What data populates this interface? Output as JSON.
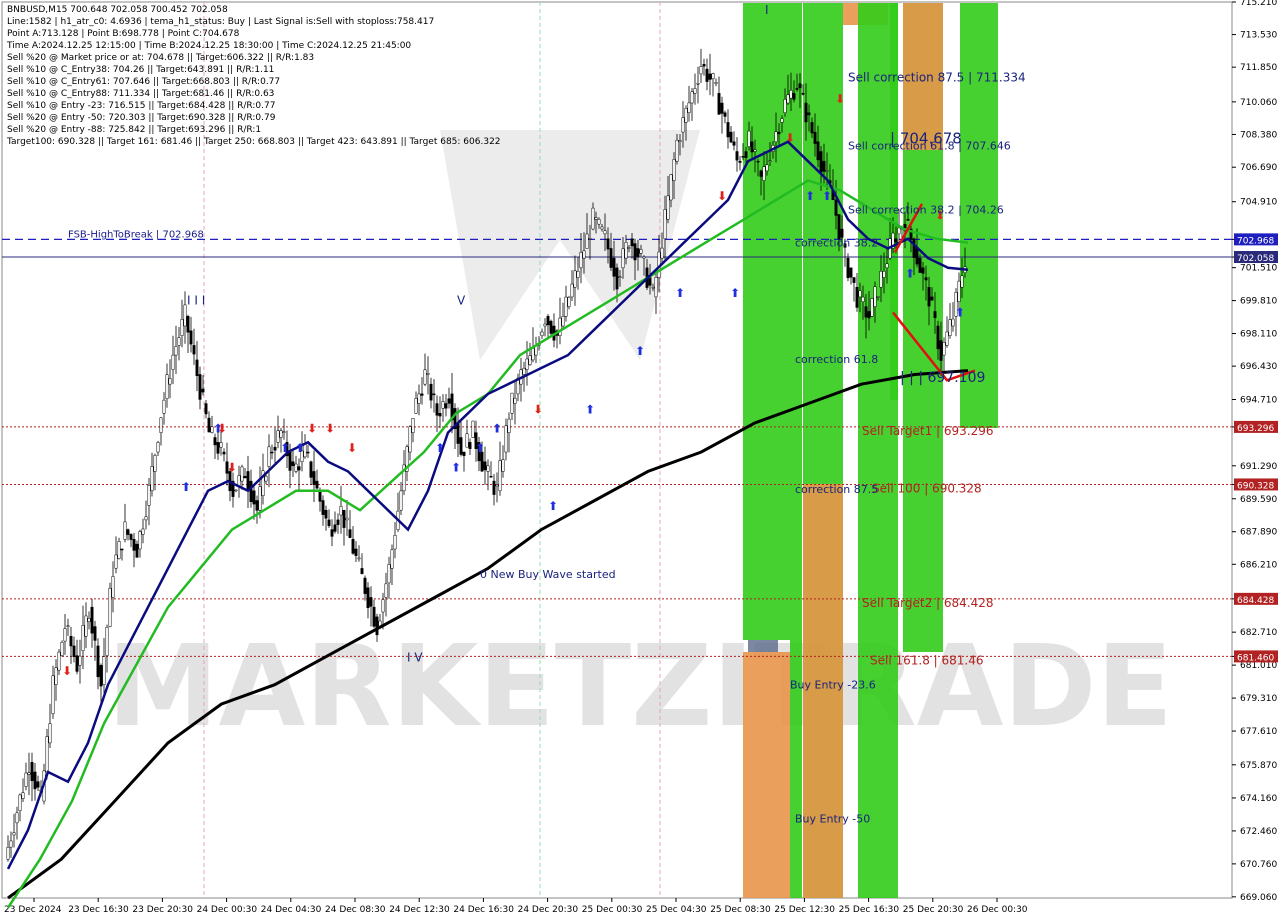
{
  "header": {
    "symbol_line": "BNBUSD,M15  700.648 702.058 700.452 702.058",
    "lines": [
      "Line:1582 | h1_atr_c0: 4.6936 | tema_h1_status: Buy | Last Signal is:Sell with stoploss:758.417",
      "Point A:713.128 | Point B:698.778 | Point C:704.678",
      "Time A:2024.12.25 12:15:00 | Time B:2024.12.25 18:30:00 | Time C:2024.12.25 21:45:00",
      "Sell %20 @ Market price or at: 704.678 || Target:606.322 || R/R:1.83",
      "Sell %10 @ C_Entry38: 704.26 || Target:643.891 || R/R:1.11",
      "Sell %10 @ C_Entry61: 707.646 || Target:668.803 || R/R:0.77",
      "Sell %10 @ C_Entry88: 711.334 || Target:681.46 || R/R:0.63",
      "Sell %10 @ Entry -23: 716.515 || Target:684.428 || R/R:0.77",
      "Sell %20 @ Entry -50: 720.303 || Target:690.328 || R/R:0.79",
      "Sell %20 @ Entry -88: 725.842 || Target:693.296 || R/R:1",
      "Target100: 690.328 || Target 161: 681.46 || Target 250: 668.803 || Target 423: 643.891 || Target 685: 606.322"
    ]
  },
  "watermark": "MARKETZITRADE",
  "chart_data": {
    "type": "candlestick",
    "symbol": "BNBUSD",
    "timeframe": "M15",
    "ylim": [
      669.0,
      715.21
    ],
    "y_ticks": [
      "715.210",
      "713.530",
      "711.850",
      "710.060",
      "708.380",
      "706.690",
      "704.910",
      "702.968",
      "702.058",
      "701.510",
      "699.810",
      "698.110",
      "696.430",
      "694.710",
      "693.296",
      "691.290",
      "690.328",
      "689.590",
      "687.890",
      "686.210",
      "684.428",
      "682.710",
      "681.460",
      "681.010",
      "679.310",
      "677.610",
      "675.870",
      "674.160",
      "672.460",
      "670.760",
      "669.060"
    ],
    "x_ticks": [
      "23 Dec 2024",
      "23 Dec 16:30",
      "23 Dec 20:30",
      "24 Dec 00:30",
      "24 Dec 04:30",
      "24 Dec 08:30",
      "24 Dec 12:30",
      "24 Dec 16:30",
      "24 Dec 20:30",
      "25 Dec 00:30",
      "25 Dec 04:30",
      "25 Dec 08:30",
      "25 Dec 12:30",
      "25 Dec 16:30",
      "25 Dec 20:30",
      "26 Dec 00:30"
    ],
    "close_path": [
      671,
      673.5,
      676,
      674,
      680,
      683,
      681,
      684,
      680,
      686,
      688,
      687,
      690,
      694,
      697,
      699,
      696,
      693,
      692,
      690,
      691,
      689,
      692,
      693,
      691,
      692,
      690,
      688,
      689,
      687,
      685,
      683,
      686,
      690,
      694,
      696,
      694,
      695,
      692,
      693,
      691,
      690,
      694,
      696,
      697,
      699,
      698,
      700,
      702,
      704,
      703,
      701,
      703,
      702,
      700,
      704,
      708,
      710,
      712,
      711,
      709,
      707,
      708,
      706,
      708,
      710,
      711,
      709,
      707,
      705,
      702,
      700,
      699,
      701,
      703,
      704,
      702,
      700,
      697,
      699,
      702
    ],
    "ema_dark_path": [
      670.5,
      672.5,
      675.5,
      675,
      677,
      680,
      682,
      684,
      686,
      688,
      690,
      690.5,
      690,
      691,
      692,
      692.5,
      691.5,
      691,
      690,
      689,
      688,
      690,
      693,
      694,
      695,
      695.5,
      696,
      696.5,
      697,
      698,
      699,
      700,
      701,
      702,
      703,
      704,
      705,
      707,
      707.5,
      708,
      707,
      706,
      704,
      703,
      702.5,
      703,
      702,
      701.5,
      701.4
    ],
    "ema_green_path": [
      668.5,
      671,
      674,
      678,
      681,
      684,
      686,
      688,
      689,
      690,
      690,
      689,
      690.5,
      692,
      694,
      695,
      697,
      698,
      699,
      700,
      701,
      702,
      703,
      704,
      705,
      706,
      705.5,
      704.5,
      703.5,
      703,
      702.8
    ],
    "ema_black_path": [
      669,
      671,
      674,
      677,
      679,
      680,
      681.5,
      683,
      684.5,
      686,
      688,
      689.5,
      691,
      692,
      693.5,
      694.5,
      695.5,
      696,
      696.2
    ],
    "levels": [
      {
        "label": "FSB-HighToBreak | 702.968",
        "price": 702.968,
        "color": "#1f1fbf",
        "style": "dashed"
      },
      {
        "label": "",
        "price": 702.058,
        "color": "#2a2a7a",
        "style": "solid"
      },
      {
        "label": "Sell Target1 | 693.296",
        "price": 693.296,
        "color": "#b22222",
        "style": "dotted"
      },
      {
        "label": "Sell 100 | 690.328",
        "price": 690.328,
        "color": "#b22222",
        "style": "dotted"
      },
      {
        "label": "Sell Target2 | 684.428",
        "price": 684.428,
        "color": "#b22222",
        "style": "dotted"
      },
      {
        "label": "Sell 161.8 | 681.46",
        "price": 681.46,
        "color": "#b22222",
        "style": "dotted"
      }
    ],
    "price_tags": [
      {
        "text": "702.968",
        "price": 702.968,
        "color": "#1f1fbf"
      },
      {
        "text": "702.058",
        "price": 702.058,
        "color": "#2a2a7a"
      },
      {
        "text": "693.296",
        "price": 693.296,
        "color": "#b22222"
      },
      {
        "text": "690.328",
        "price": 690.328,
        "color": "#b22222"
      },
      {
        "text": "684.428",
        "price": 684.428,
        "color": "#b22222"
      },
      {
        "text": "681.460",
        "price": 681.46,
        "color": "#b22222"
      }
    ],
    "annotations": [
      {
        "text": "Sell correction 87.5 | 711.334",
        "color": "#1a237e"
      },
      {
        "text": "Sell correction 61.8 | 707.646",
        "color": "#1a237e"
      },
      {
        "text": "Sell correction 38.2 | 704.26",
        "color": "#1a237e"
      },
      {
        "text": "correction 38.2",
        "color": "#1a237e"
      },
      {
        "text": "correction 61.8",
        "color": "#1a237e"
      },
      {
        "text": "correction 87.5",
        "color": "#1a237e"
      },
      {
        "text": "Buy Entry -23.6",
        "color": "#1a237e"
      },
      {
        "text": "Buy Entry -50",
        "color": "#1a237e"
      },
      {
        "text": "0 New Buy Wave started",
        "color": "#1a237e"
      },
      {
        "text": "| | | 697.109",
        "color": "#1a237e"
      },
      {
        "text": "| 704.678",
        "color": "#1a237e"
      },
      {
        "text": "I I I",
        "color": "#1a237e"
      },
      {
        "text": "V",
        "color": "#1a237e"
      },
      {
        "text": "I V",
        "color": "#1a237e"
      },
      {
        "text": "I",
        "color": "#1a237e"
      }
    ],
    "colors": {
      "bullish_zone": "#33cc1a",
      "bearish_zone": "#e8954a",
      "candle": "#000000",
      "ema_fast": "#0b0b80",
      "ema_mid": "#22bb22",
      "ema_slow": "#000000",
      "buy_arrow": "#1f2fe0",
      "sell_arrow": "#e0201a",
      "grid": "#e8e8e8"
    }
  }
}
